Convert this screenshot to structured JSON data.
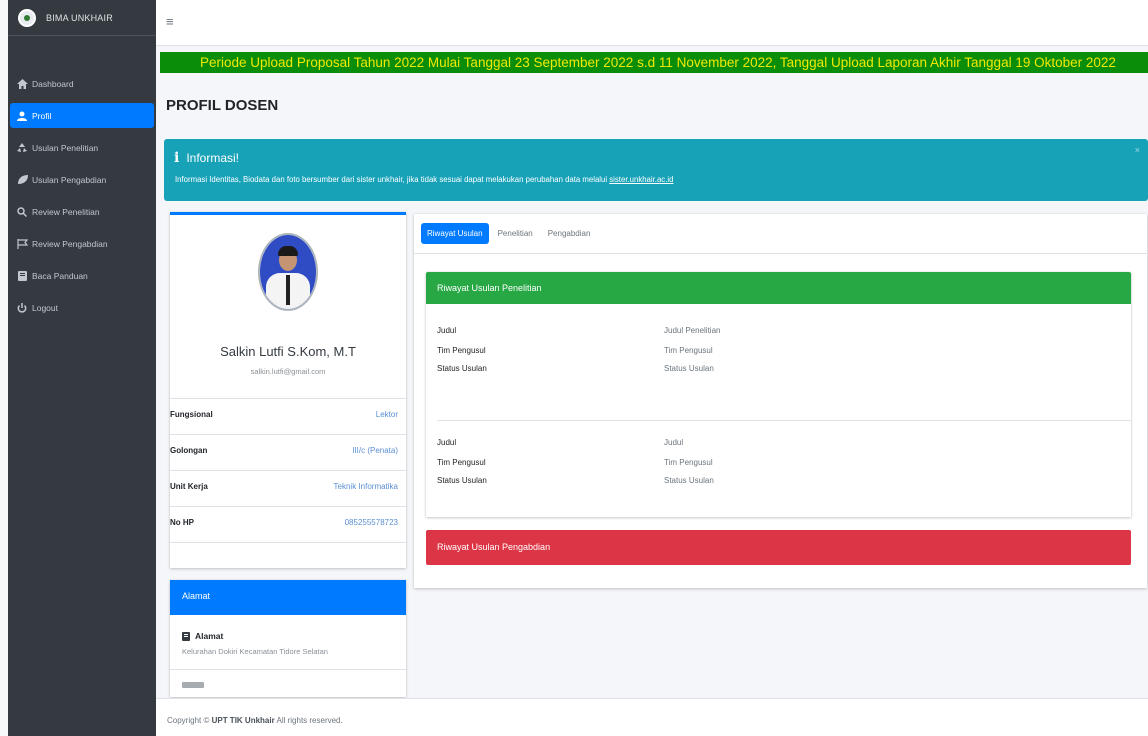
{
  "brand": {
    "name": "BIMA UNKHAIR"
  },
  "sidebar": {
    "items": [
      {
        "label": "Dashboard",
        "icon": "home-icon"
      },
      {
        "label": "Profil",
        "icon": "user-icon",
        "active": true
      },
      {
        "label": "Usulan Penelitian",
        "icon": "recycle-icon"
      },
      {
        "label": "Usulan Pengabdian",
        "icon": "leaf-icon"
      },
      {
        "label": "Review Penelitian",
        "icon": "search-icon"
      },
      {
        "label": "Review Pengabdian",
        "icon": "flag-icon"
      },
      {
        "label": "Baca Panduan",
        "icon": "book-icon"
      },
      {
        "label": "Logout",
        "icon": "power-icon"
      }
    ]
  },
  "announcement": "Periode Upload Proposal Tahun 2022 Mulai Tanggal 23 September 2022 s.d 11 November 2022, Tanggal Upload Laporan Akhir Tanggal 19 Oktober 2022",
  "page_title": "PROFIL DOSEN",
  "callout": {
    "title": "Informasi!",
    "text": "Informasi Identitas, Biodata dan foto bersumber dari sister unkhair, jika tidak sesuai dapat melakukan perubahan data melalui ",
    "link": "sister.unkhair.ac.id",
    "close": "×"
  },
  "profile": {
    "name": "Salkin Lutfi S.Kom, M.T",
    "email": "salkin.lutfi@gmail.com",
    "rows": [
      {
        "label": "Fungsional",
        "value": "Lektor"
      },
      {
        "label": "Golongan",
        "value": "III/c (Penata)"
      },
      {
        "label": "Unit Kerja",
        "value": "Teknik Informatika"
      },
      {
        "label": "No HP",
        "value": "085255578723"
      }
    ]
  },
  "alamat": {
    "header": "Alamat",
    "label": "Alamat",
    "value": "Kelurahan Dokiri Kecamatan Tidore Selatan"
  },
  "tabs": [
    "Riwayat Usulan",
    "Penelitian",
    "Pengabdian"
  ],
  "riwayat_penelitian": {
    "header": "Riwayat Usulan Penelitian",
    "entries": [
      {
        "judul_label": "Judul",
        "judul": "Judul Penelitian",
        "tim_label": "Tim Pengusul",
        "tim": "Tim Pengusul",
        "status_label": "Status Usulan",
        "status": "Status Usulan"
      },
      {
        "judul_label": "Judul",
        "judul": "Judul",
        "tim_label": "Tim Pengusul",
        "tim": "Tim Pengusul",
        "status_label": "Status Usulan",
        "status": "Status Usulan"
      }
    ]
  },
  "riwayat_pengabdian": {
    "header": "Riwayat Usulan Pengabdian"
  },
  "footer": {
    "prefix": "Copyright © ",
    "owner": "UPT TIK Unkhair",
    "suffix": " All rights reserved."
  },
  "colors": {
    "primary": "#007bff",
    "success": "#28a745",
    "danger": "#dc3545",
    "info": "#17a2b8",
    "sidebar": "#343a40",
    "announce_bg": "#0a8e0a",
    "announce_text": "#f1e900"
  }
}
